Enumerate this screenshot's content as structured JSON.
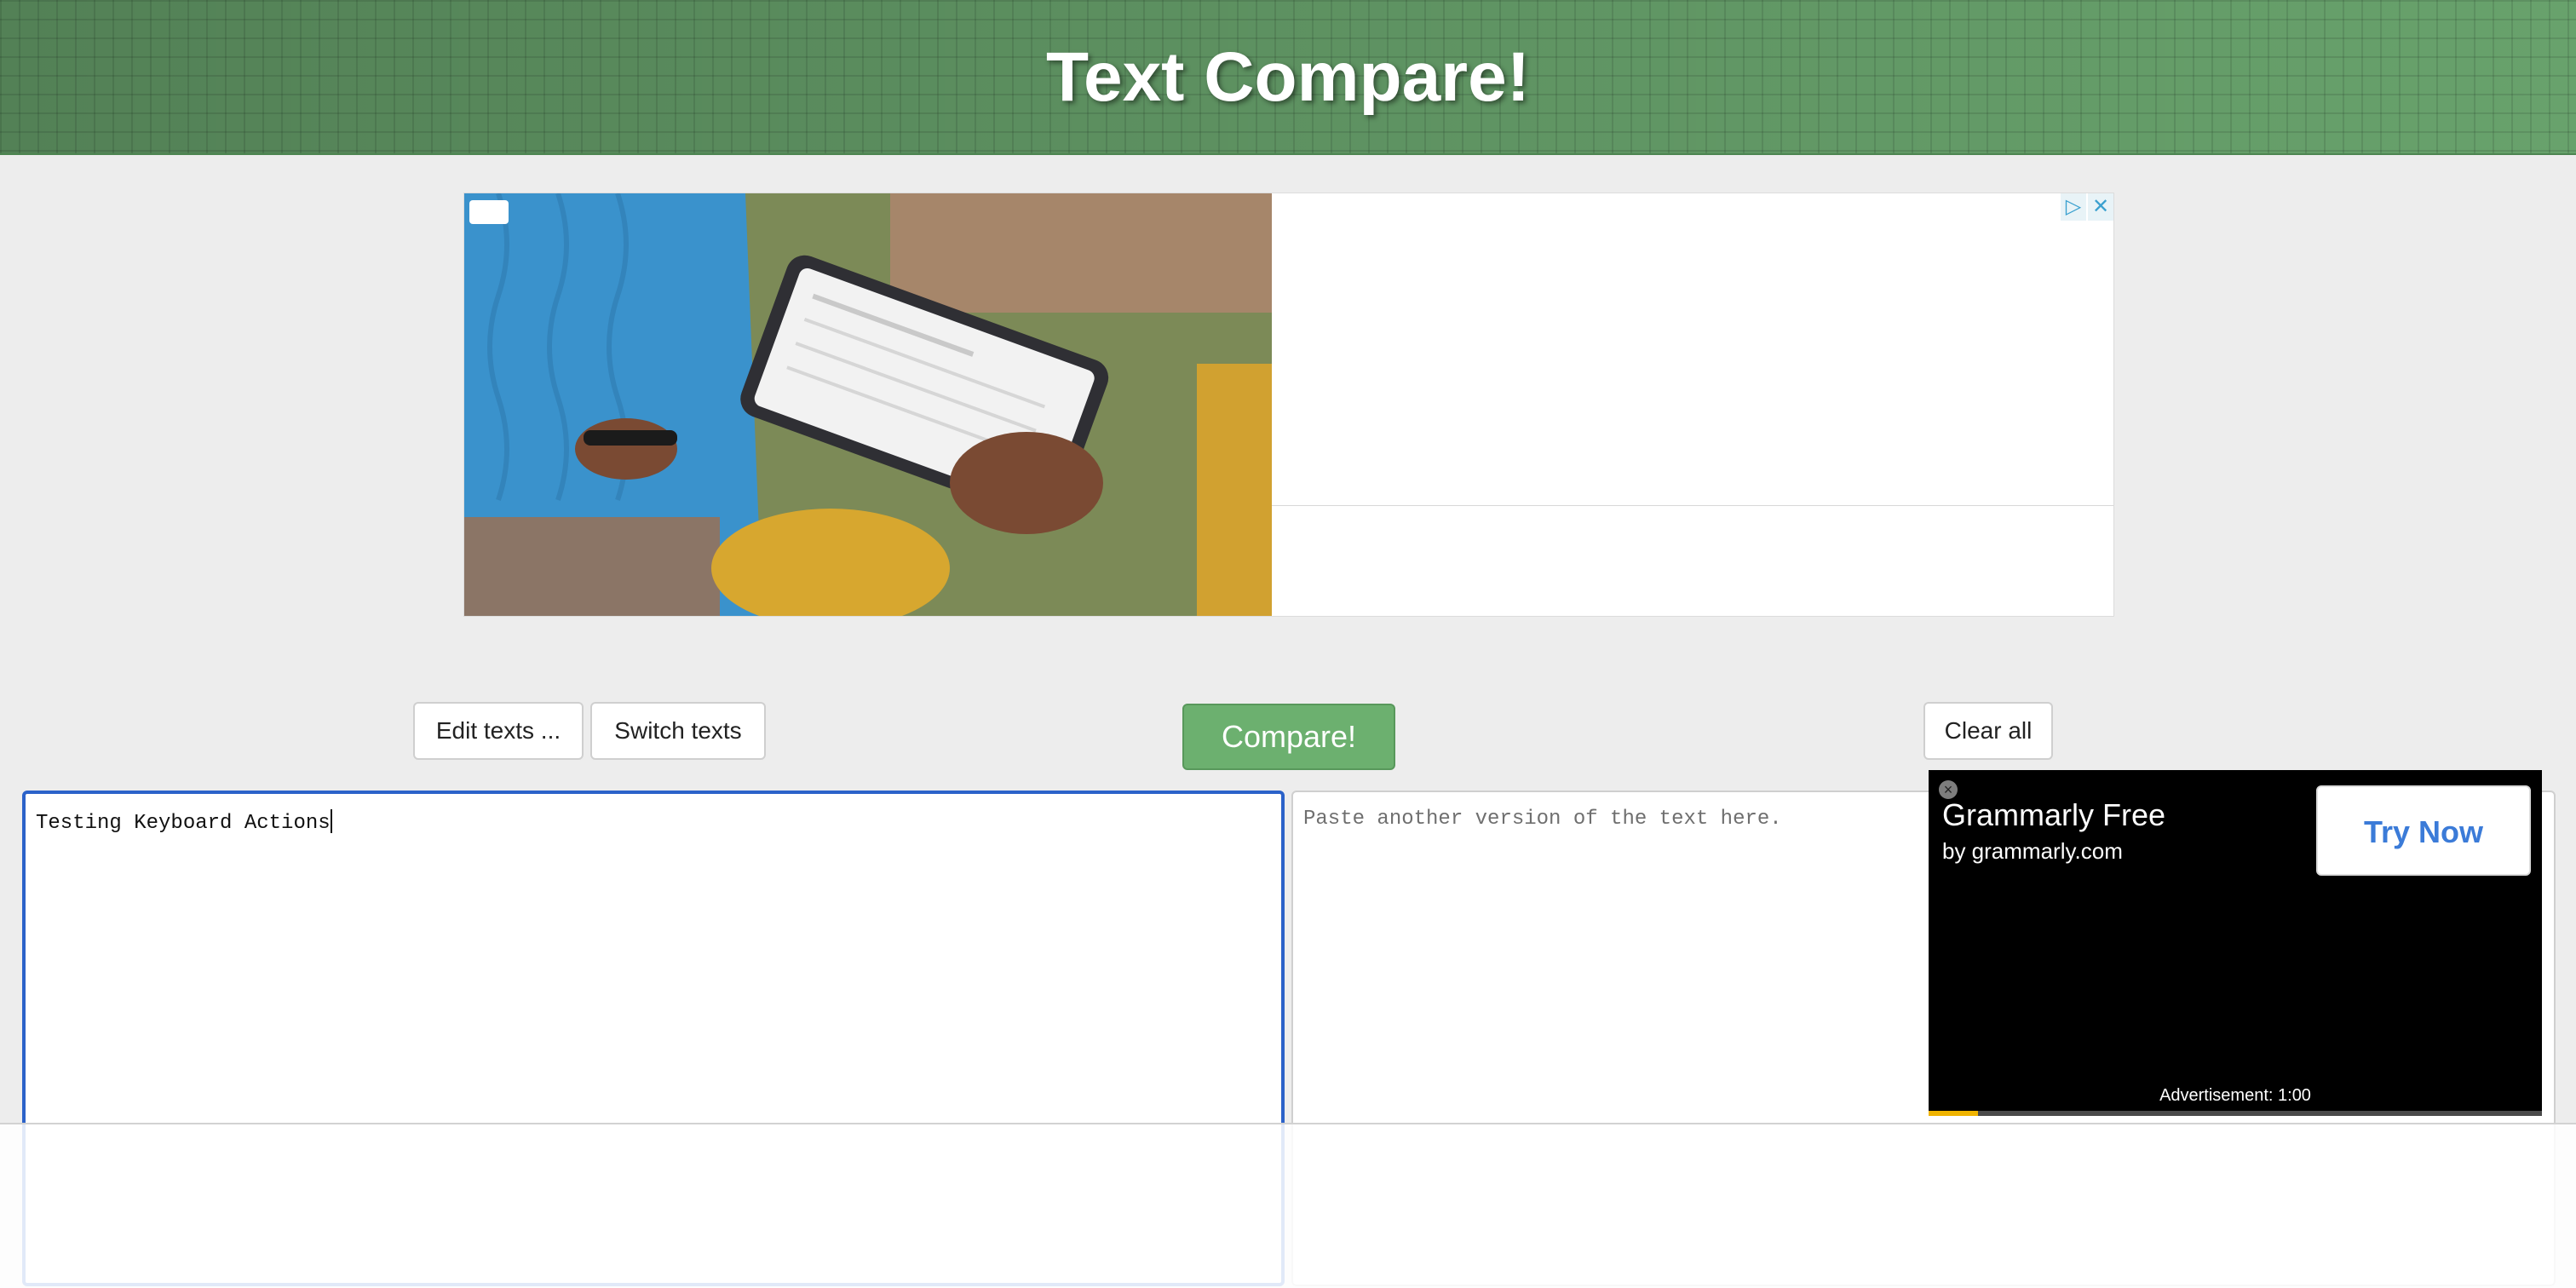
{
  "header": {
    "title": "Text Compare!"
  },
  "ad_top": {
    "info_icon": "ad-choices-icon",
    "close_icon": "close-icon"
  },
  "toolbar": {
    "edit_label": "Edit texts ...",
    "switch_label": "Switch texts",
    "compare_label": "Compare!",
    "clear_label": "Clear all",
    "compare_color": "#6cb06f"
  },
  "left_text": {
    "value": "Testing Keyboard Actions"
  },
  "right_text": {
    "value": "",
    "placeholder": "Paste another version of the text here."
  },
  "video_ad": {
    "title": "Grammarly Free",
    "subtitle": "by grammarly.com",
    "cta": "Try Now",
    "timer": "Advertisement: 1:00",
    "progress": 0.08
  }
}
